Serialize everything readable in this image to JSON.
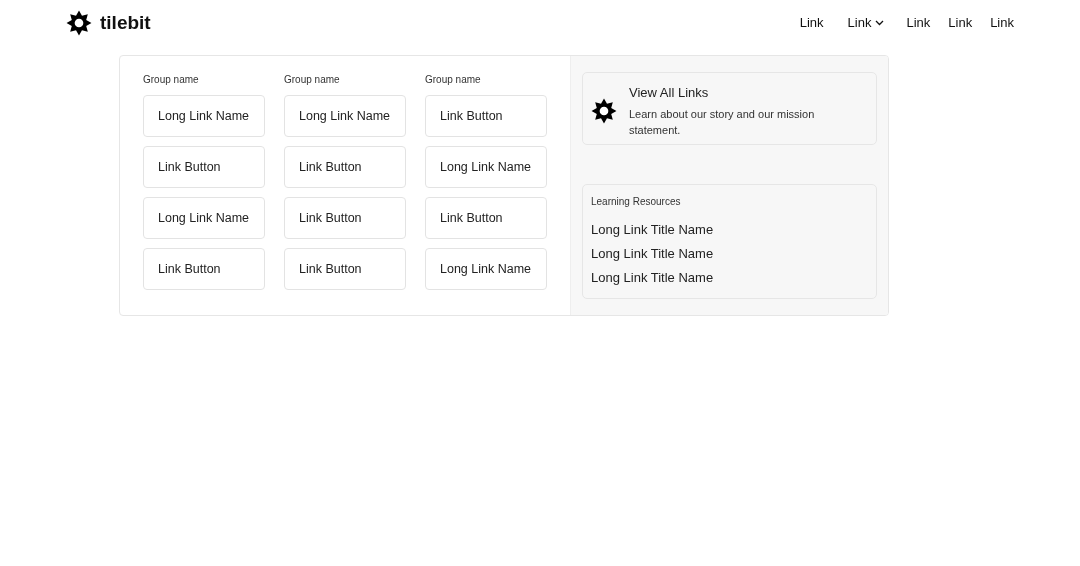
{
  "brand": {
    "name": "tilebit"
  },
  "nav": [
    {
      "label": "Link",
      "kind": "link"
    },
    {
      "label": "Link",
      "kind": "dropdown"
    },
    {
      "label": "Link",
      "kind": "link"
    },
    {
      "label": "Link",
      "kind": "link"
    },
    {
      "label": "Link",
      "kind": "link"
    }
  ],
  "menu": {
    "groups": [
      {
        "title": "Group name",
        "links": [
          "Long Link Name",
          "Link Button",
          "Long Link Name",
          "Link Button"
        ]
      },
      {
        "title": "Group name",
        "links": [
          "Long Link Name",
          "Link Button",
          "Link Button",
          "Link Button"
        ]
      },
      {
        "title": "Group name",
        "links": [
          "Link Button",
          "Long Link Name",
          "Link Button",
          "Long Link Name"
        ]
      }
    ],
    "feature": {
      "title": "View All Links",
      "description": "Learn about our story and our mission statement."
    },
    "resources": {
      "title": "Learning Resources",
      "links": [
        "Long Link Title Name",
        "Long Link Title Name",
        "Long Link Title Name"
      ]
    }
  }
}
